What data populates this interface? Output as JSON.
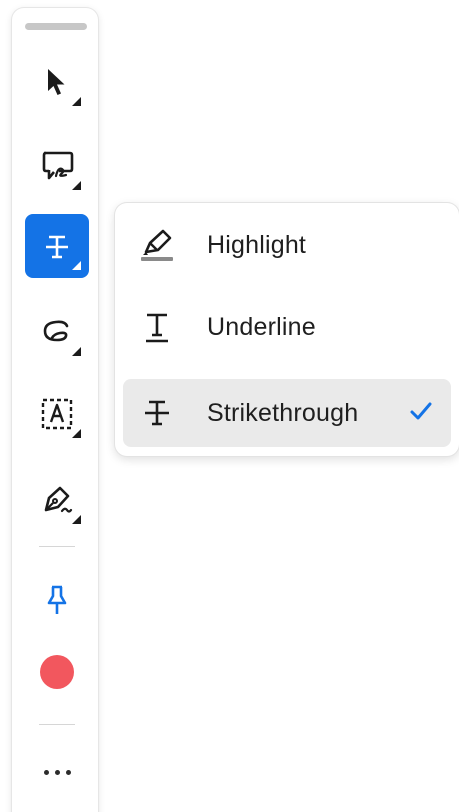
{
  "toolbar": {
    "tools": [
      {
        "id": "select",
        "icon": "pointer-arrow-icon",
        "has_submenu": true
      },
      {
        "id": "comment",
        "icon": "comment-bubble-icon",
        "has_submenu": true
      },
      {
        "id": "text-markup",
        "icon": "strikethrough-icon",
        "has_submenu": true,
        "selected": true
      },
      {
        "id": "freehand",
        "icon": "lasso-icon",
        "has_submenu": true
      },
      {
        "id": "text-box",
        "icon": "text-box-icon",
        "has_submenu": true
      },
      {
        "id": "sign",
        "icon": "pen-sign-icon",
        "has_submenu": true
      }
    ],
    "pin_icon": "pushpin-icon",
    "active_color": "#f2575e",
    "more_icon": "ellipsis-icon",
    "accent_color": "#1473e6"
  },
  "markup_menu": {
    "items": [
      {
        "label": "Highlight",
        "icon": "highlighter-icon"
      },
      {
        "label": "Underline",
        "icon": "underline-icon"
      },
      {
        "label": "Strikethrough",
        "icon": "strikethrough-icon",
        "checked": true
      }
    ],
    "check_icon": "checkmark-icon"
  }
}
